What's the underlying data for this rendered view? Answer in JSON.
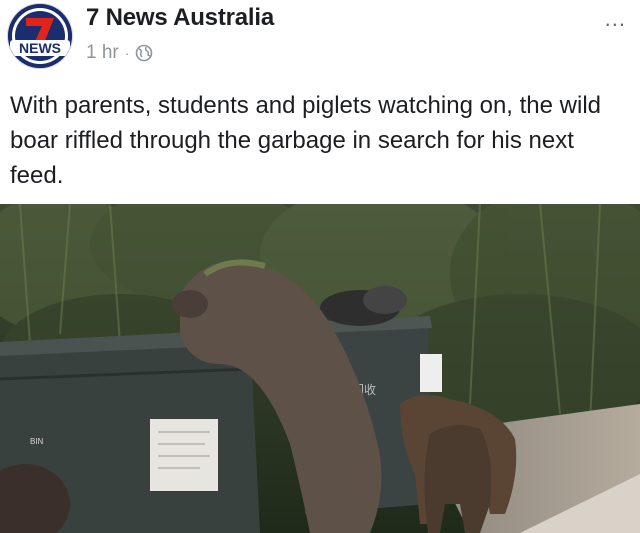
{
  "post": {
    "author": "7 News Australia",
    "avatar": {
      "logo_number": "7",
      "logo_text": "NEWS",
      "brand_color": "#e2231a"
    },
    "time": "1 hr",
    "separator": "·",
    "audience_icon": "globe-icon",
    "more_label": "...",
    "text": "With parents, students and piglets watching on, the wild boar riffled through the garbage in search for his next feed."
  },
  "photo": {
    "bin_label_sign": "BIN",
    "bin_label_right": "回收"
  }
}
